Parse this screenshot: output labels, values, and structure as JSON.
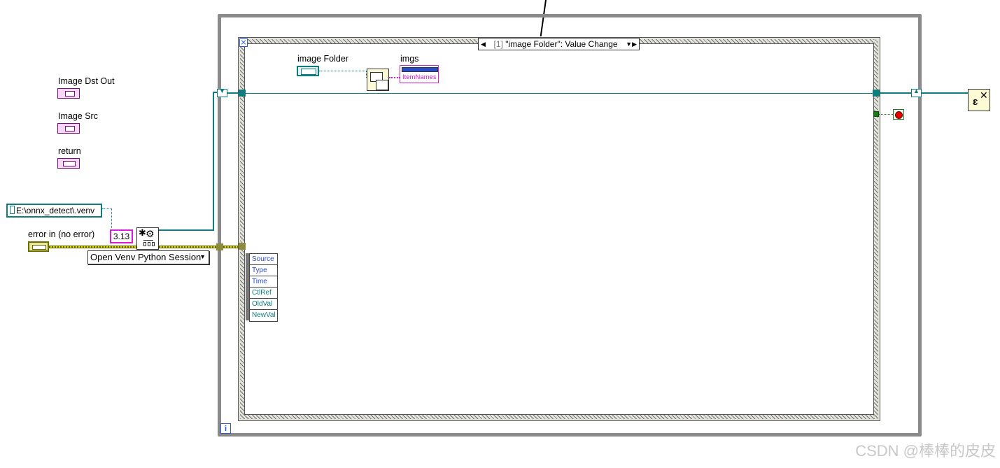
{
  "indicators": [
    {
      "label": "Image Dst Out"
    },
    {
      "label": "Image Src"
    },
    {
      "label": "return"
    }
  ],
  "venv_path_constant": "E:\\onnx_detect\\.venv",
  "error_in_label": "error in (no error)",
  "python_version_constant": "3.13",
  "python_node_ring": "Open Venv Python Session",
  "event_case_selector": "[1] \"image Folder\": Value Change",
  "event_case_index": "[1]",
  "event_case_name": "\"image Folder\": Value Change",
  "image_folder_label": "image Folder",
  "imgs_label": "imgs",
  "imgs_property": "ItemNames",
  "event_data_fields": [
    "Source",
    "Type",
    "Time",
    "CtlRef",
    "OldVal",
    "NewVal"
  ],
  "iteration_terminal": "i",
  "watermark": "CSDN @棒棒的皮皮",
  "colors": {
    "wire_teal": "#0f7d7d",
    "wire_pink": "#d41fd4",
    "error_cluster": "#e8e800",
    "loop_border": "#8a8a8a"
  }
}
